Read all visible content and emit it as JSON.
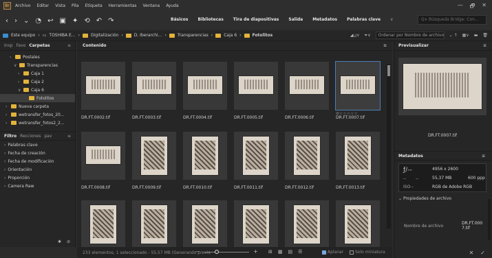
{
  "menu": {
    "items": [
      "Archivo",
      "Editar",
      "Vista",
      "Pila",
      "Etiqueta",
      "Herramientas",
      "Ventana",
      "Ayuda"
    ],
    "app_icon": "Br"
  },
  "window_controls": [
    "—",
    "🗗",
    "✕"
  ],
  "toolbar": {
    "workspaces": [
      "Básicos",
      "Bibliotecas",
      "Tira de diapositivas",
      "Salida",
      "Metadatos",
      "Palabras clave"
    ],
    "ws_chevron": "∨",
    "search_placeholder": "Q∨  Búsqueda Bridge: Con..."
  },
  "path": {
    "crumbs": [
      "Este equipo",
      "TOSHIBA E...",
      "Digitalización",
      "D. Iberarchi...",
      "Transparencias",
      "Caja 6",
      "Fotolitos"
    ],
    "sort_label": "Ordenar por Nombre de archivo"
  },
  "left_panel": {
    "tabs": [
      "Insp",
      "Favo",
      "Carpetas"
    ],
    "tree": [
      {
        "label": "Postales",
        "indent": 14,
        "arrow": "›"
      },
      {
        "label": "Transparencias",
        "indent": 20,
        "arrow": "∨"
      },
      {
        "label": "Caja 1",
        "indent": 26,
        "arrow": "›"
      },
      {
        "label": "Caja 2",
        "indent": 26,
        "arrow": "›"
      },
      {
        "label": "Caja 6",
        "indent": 26,
        "arrow": "∨"
      },
      {
        "label": "Fotolitos",
        "indent": 34,
        "arrow": "",
        "selected": true
      },
      {
        "label": "Nueva carpeta",
        "indent": 8,
        "arrow": "›"
      },
      {
        "label": "wetransfer_fotos_20...",
        "indent": 8,
        "arrow": "›"
      },
      {
        "label": "wetransfer_fotos2_2...",
        "indent": 8,
        "arrow": "›"
      }
    ],
    "filter_tabs": [
      "Filtro",
      "Recciones",
      "pav"
    ],
    "filters": [
      "Palabras clave",
      "Fecha de creación",
      "Fecha de modificación",
      "Orientación",
      "Proporción",
      "Camera Raw"
    ]
  },
  "content": {
    "tab_label": "Contenido",
    "items": [
      {
        "name": "DR.FT.0002.tif",
        "kind": "wide"
      },
      {
        "name": "DR.FT.0003.tif",
        "kind": "wide"
      },
      {
        "name": "DR.FT.0004.tif",
        "kind": "wide"
      },
      {
        "name": "DR.FT.0005.tif",
        "kind": "wide"
      },
      {
        "name": "DR.FT.0006.tif",
        "kind": "wide"
      },
      {
        "name": "DR.FT.0007.tif",
        "kind": "wide",
        "selected": true,
        "stars": "⊘☆☆☆☆☆"
      },
      {
        "name": "DR.FT.0008.tif",
        "kind": "wide"
      },
      {
        "name": "DR.FT.0009.tif",
        "kind": "photo"
      },
      {
        "name": "DR.FT.0010.tif",
        "kind": "photo"
      },
      {
        "name": "DR.FT.0011.tif",
        "kind": "photo"
      },
      {
        "name": "DR.FT.0012.tif",
        "kind": "photo"
      },
      {
        "name": "DR.FT.0013.tif",
        "kind": "photo"
      },
      {
        "name": "",
        "kind": "photo"
      },
      {
        "name": "",
        "kind": "photo"
      },
      {
        "name": "",
        "kind": "photo"
      },
      {
        "name": "",
        "kind": "photo"
      },
      {
        "name": "",
        "kind": "photo"
      },
      {
        "name": "",
        "kind": "photo"
      }
    ]
  },
  "status": {
    "text": "233 elementos, 1 seleccionado - 55,57 MB (Generando previs",
    "minus": "—",
    "plus": "+",
    "view_icons": [
      "⊞",
      "▦",
      "▤",
      "☰"
    ],
    "aplanar": "Aplanar",
    "solo_miniatura": "Solo miniatura"
  },
  "right_panel": {
    "preview_tab": "Previsualizar",
    "preview_name": "DR.FT.0007.tif",
    "metadata_tab": "Metadatos",
    "meta_fstop": "ƒ/--",
    "meta_dashes": [
      "--",
      "--"
    ],
    "meta_iso": "ISO--",
    "meta_dims": "4956 x 2600",
    "meta_size": "55,37 MB",
    "meta_ppp": "600 ppp",
    "meta_rgb": "RGB de Adobe  RGB",
    "props_label": "Propiedades de archivo",
    "filename_label": "Nombre de archivo",
    "filename_value": "DR.FT.000 7.tif"
  }
}
